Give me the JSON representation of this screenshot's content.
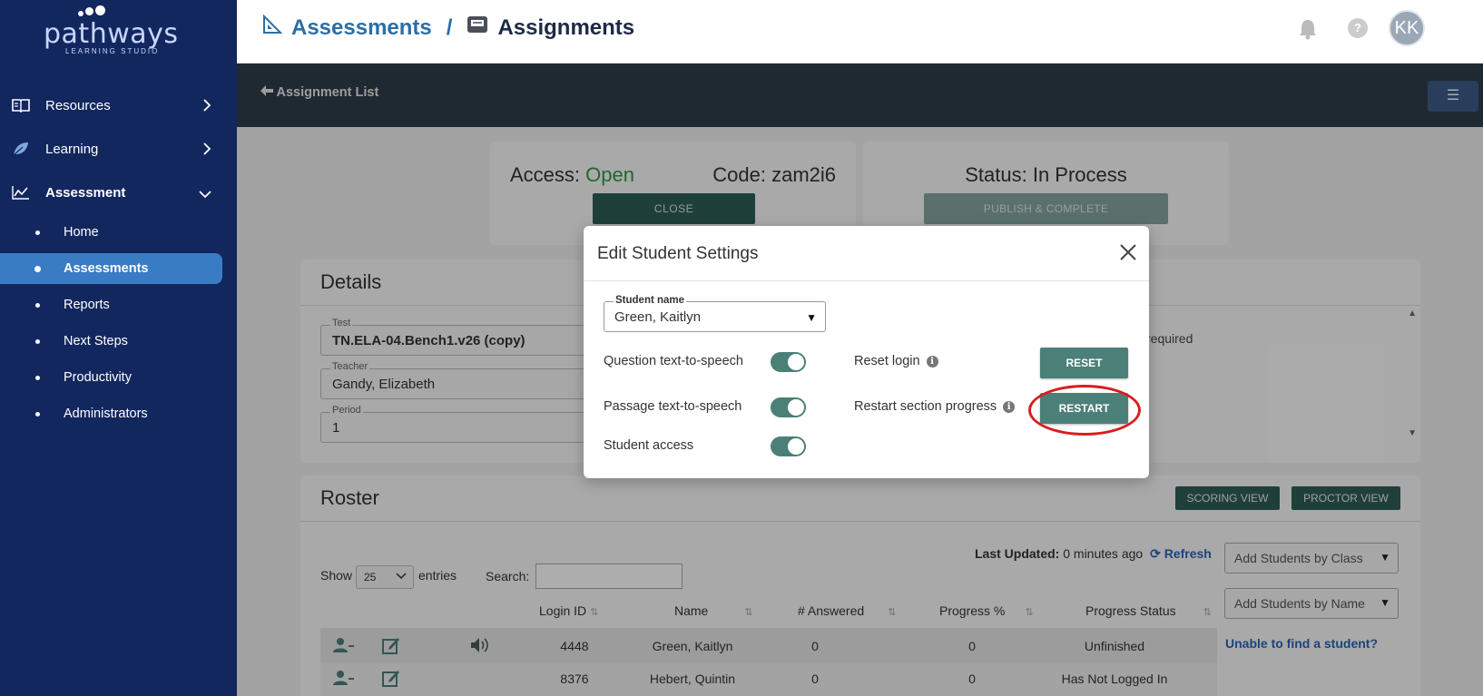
{
  "brand": {
    "name": "pathways",
    "subtitle": "LEARNING STUDIO"
  },
  "sidebar": {
    "items": [
      {
        "label": "Resources",
        "icon": "book-icon",
        "chevron": "chevron-right-icon"
      },
      {
        "label": "Learning",
        "icon": "leaf-icon",
        "chevron": "chevron-right-icon"
      },
      {
        "label": "Assessment",
        "icon": "chart-line-icon",
        "chevron": "chevron-down-icon"
      }
    ],
    "subitems": [
      "Home",
      "Assessments",
      "Reports",
      "Next Steps",
      "Productivity",
      "Administrators"
    ],
    "active_subitem": "Assessments"
  },
  "header": {
    "crumb1": "Assessments",
    "separator": "/",
    "crumb2": "Assignments",
    "avatar_initials": "KK",
    "help_label": "?"
  },
  "subbar": {
    "back_label": "Assignment List"
  },
  "access": {
    "access_label": "Access:",
    "access_value": "Open",
    "code_label": "Code:",
    "code_value": "zam2i6",
    "close_button": "CLOSE"
  },
  "status": {
    "label": "Status:",
    "value": "In Process",
    "publish_button": "PUBLISH & COMPLETE"
  },
  "details": {
    "title": "Details",
    "test_label": "Test",
    "test_value": "TN.ELA-04.Bench1.v26 (copy)",
    "teacher_label": "Teacher",
    "teacher_value": "Gandy, Elizabeth",
    "period_label": "Period",
    "period_value": "1",
    "required_text": "required"
  },
  "roster": {
    "title": "Roster",
    "scoring_view": "SCORING VIEW",
    "proctor_view": "PROCTOR VIEW",
    "show_label": "Show",
    "entries_value": "25",
    "entries_label": "entries",
    "search_label": "Search:",
    "last_updated_label": "Last Updated:",
    "last_updated_value": "0 minutes ago",
    "refresh_label": "Refresh",
    "add_by_class": "Add Students by Class",
    "add_by_name": "Add Students by Name",
    "unable_link": "Unable to find a student?",
    "columns": [
      "Login ID",
      "Name",
      "# Answered",
      "Progress %",
      "Progress Status"
    ],
    "rows": [
      {
        "login_id": "4448",
        "name": "Green, Kaitlyn",
        "answered": "0",
        "progress": "0",
        "status": "Unfinished"
      },
      {
        "login_id": "8376",
        "name": "Hebert, Quintin",
        "answered": "0",
        "progress": "0",
        "status": "Has Not Logged In"
      }
    ]
  },
  "modal": {
    "title": "Edit Student Settings",
    "student_label": "Student name",
    "student_value": "Green, Kaitlyn",
    "question_tts": "Question text-to-speech",
    "passage_tts": "Passage text-to-speech",
    "student_access": "Student access",
    "reset_login": "Reset login",
    "restart_section": "Restart section progress",
    "reset_button": "RESET",
    "restart_button": "RESTART",
    "toggles": {
      "question_tts": true,
      "passage_tts": true,
      "student_access": true
    }
  },
  "colors": {
    "sidebar_bg": "#13275f",
    "active_item": "#3a7cc4",
    "teal_button": "#4b8078",
    "open_green": "#2e9a4a",
    "highlight_red": "#d81e1e"
  }
}
